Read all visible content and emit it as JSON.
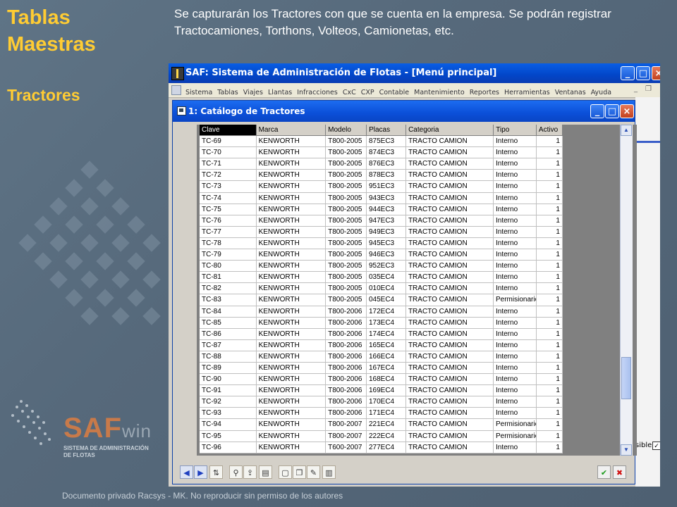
{
  "slide": {
    "title_line1": "Tablas",
    "title_line2": "Maestras",
    "subtitle": "Tractores",
    "description": "Se capturarán los Tractores con que se cuenta en la empresa. Se podrán registrar Tractocamiones, Torthons, Volteos, Camionetas, etc.",
    "footer": "Documento privado Racsys - MK. No reproducir sin permiso de los autores",
    "logo_saf": "SAF",
    "logo_win": "win",
    "logo_line1": "SISTEMA DE ADMINISTRACIÓN",
    "logo_line2": "DE FLOTAS"
  },
  "app": {
    "title": "SAF: Sistema de Administración de Flotas - [Menú principal]",
    "menu": [
      "Sistema",
      "Tablas",
      "Viajes",
      "Llantas",
      "Infracciones",
      "CxC",
      "CXP",
      "Contable",
      "Mantenimiento",
      "Reportes",
      "Herramientas",
      "Ventanas",
      "Ayuda"
    ],
    "controls": {
      "minimize": "_",
      "maximize": "□",
      "close": "×"
    },
    "visible_label": "sible",
    "visible_checked": true
  },
  "child": {
    "title": "1: Catálogo de Tractores",
    "columns": [
      "Clave",
      "Marca",
      "Modelo",
      "Placas",
      "Categoria",
      "Tipo",
      "Activo"
    ],
    "rows": [
      [
        "TC-69",
        "KENWORTH",
        "T800-2005",
        "875EC3",
        "TRACTO CAMION",
        "Interno",
        "1"
      ],
      [
        "TC-70",
        "KENWORTH",
        "T800-2005",
        "874EC3",
        "TRACTO CAMION",
        "Interno",
        "1"
      ],
      [
        "TC-71",
        "KENWORTH",
        "T800-2005",
        "876EC3",
        "TRACTO CAMION",
        "Interno",
        "1"
      ],
      [
        "TC-72",
        "KENWORTH",
        "T800-2005",
        "878EC3",
        "TRACTO CAMION",
        "Interno",
        "1"
      ],
      [
        "TC-73",
        "KENWORTH",
        "T800-2005",
        "951EC3",
        "TRACTO CAMION",
        "Interno",
        "1"
      ],
      [
        "TC-74",
        "KENWORTH",
        "T800-2005",
        "943EC3",
        "TRACTO CAMION",
        "Interno",
        "1"
      ],
      [
        "TC-75",
        "KENWORTH",
        "T800-2005",
        "944EC3",
        "TRACTO CAMION",
        "Interno",
        "1"
      ],
      [
        "TC-76",
        "KENWORTH",
        "T800-2005",
        "947EC3",
        "TRACTO CAMION",
        "Interno",
        "1"
      ],
      [
        "TC-77",
        "KENWORTH",
        "T800-2005",
        "949EC3",
        "TRACTO CAMION",
        "Interno",
        "1"
      ],
      [
        "TC-78",
        "KENWORTH",
        "T800-2005",
        "945EC3",
        "TRACTO CAMION",
        "Interno",
        "1"
      ],
      [
        "TC-79",
        "KENWORTH",
        "T800-2005",
        "946EC3",
        "TRACTO CAMION",
        "Interno",
        "1"
      ],
      [
        "TC-80",
        "KENWORTH",
        "T800-2005",
        "952EC3",
        "TRACTO CAMION",
        "Interno",
        "1"
      ],
      [
        "TC-81",
        "KENWORTH",
        "T800-2005",
        "035EC4",
        "TRACTO CAMION",
        "Interno",
        "1"
      ],
      [
        "TC-82",
        "KENWORTH",
        "T800-2005",
        "010EC4",
        "TRACTO CAMION",
        "Interno",
        "1"
      ],
      [
        "TC-83",
        "KENWORTH",
        "T800-2005",
        "045EC4",
        "TRACTO CAMION",
        "Permisionario",
        "1"
      ],
      [
        "TC-84",
        "KENWORTH",
        "T800-2006",
        "172EC4",
        "TRACTO CAMION",
        "Interno",
        "1"
      ],
      [
        "TC-85",
        "KENWORTH",
        "T800-2006",
        "173EC4",
        "TRACTO CAMION",
        "Interno",
        "1"
      ],
      [
        "TC-86",
        "KENWORTH",
        "T800-2006",
        "174EC4",
        "TRACTO CAMION",
        "Interno",
        "1"
      ],
      [
        "TC-87",
        "KENWORTH",
        "T800-2006",
        "165EC4",
        "TRACTO CAMION",
        "Interno",
        "1"
      ],
      [
        "TC-88",
        "KENWORTH",
        "T800-2006",
        "166EC4",
        "TRACTO CAMION",
        "Interno",
        "1"
      ],
      [
        "TC-89",
        "KENWORTH",
        "T800-2006",
        "167EC4",
        "TRACTO CAMION",
        "Interno",
        "1"
      ],
      [
        "TC-90",
        "KENWORTH",
        "T800-2006",
        "168EC4",
        "TRACTO CAMION",
        "Interno",
        "1"
      ],
      [
        "TC-91",
        "KENWORTH",
        "T800-2006",
        "169EC4",
        "TRACTO CAMION",
        "Interno",
        "1"
      ],
      [
        "TC-92",
        "KENWORTH",
        "T800-2006",
        "170EC4",
        "TRACTO CAMION",
        "Interno",
        "1"
      ],
      [
        "TC-93",
        "KENWORTH",
        "T800-2006",
        "171EC4",
        "TRACTO CAMION",
        "Interno",
        "1"
      ],
      [
        "TC-94",
        "KENWORTH",
        "T800-2007",
        "221EC4",
        "TRACTO CAMION",
        "Permisionario",
        "1"
      ],
      [
        "TC-95",
        "KENWORTH",
        "T800-2007",
        "222EC4",
        "TRACTO CAMION",
        "Permisionario",
        "1"
      ],
      [
        "TC-96",
        "KENWORTH",
        "T600-2007",
        "277EC4",
        "TRACTO CAMION",
        "Interno",
        "1"
      ]
    ],
    "toolbar": [
      {
        "name": "first-record-button",
        "glyph": "◀",
        "kind": "nav"
      },
      {
        "name": "next-record-button",
        "glyph": "▶",
        "kind": "nav"
      },
      {
        "name": "sort-az-icon",
        "glyph": "⇅",
        "kind": "act"
      },
      {
        "name": "find-binoculars-icon",
        "glyph": "⚲",
        "kind": "act"
      },
      {
        "name": "export-icon",
        "glyph": "⇪",
        "kind": "act"
      },
      {
        "name": "save-disk-icon",
        "glyph": "▤",
        "kind": "act"
      },
      {
        "name": "new-record-icon",
        "glyph": "▢",
        "kind": "act"
      },
      {
        "name": "copy-record-icon",
        "glyph": "❐",
        "kind": "act"
      },
      {
        "name": "edit-record-icon",
        "glyph": "✎",
        "kind": "act"
      },
      {
        "name": "delete-trash-icon",
        "glyph": "▥",
        "kind": "act"
      },
      {
        "name": "accept-check-icon",
        "glyph": "✔",
        "kind": "ok"
      },
      {
        "name": "cancel-x-icon",
        "glyph": "✖",
        "kind": "cancel"
      }
    ]
  }
}
